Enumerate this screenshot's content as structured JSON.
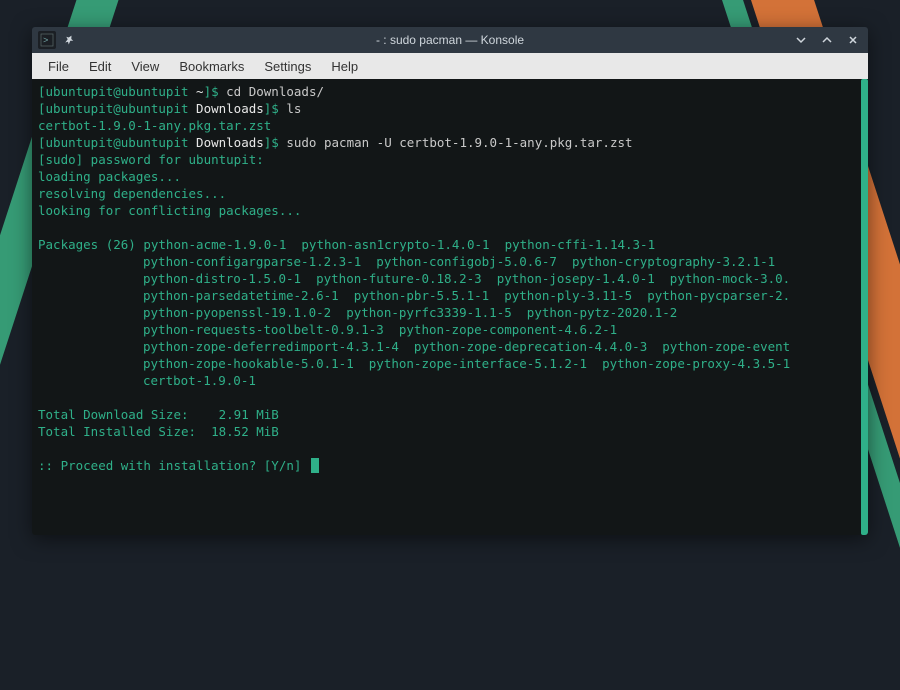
{
  "window": {
    "title": "- : sudo pacman — Konsole"
  },
  "menubar": {
    "file": "File",
    "edit": "Edit",
    "view": "View",
    "bookmarks": "Bookmarks",
    "settings": "Settings",
    "help": "Help"
  },
  "term": {
    "prompt1_userhost": "[ubuntupit@ubuntupit ",
    "prompt1_cwd": "~",
    "prompt1_end": "]$ ",
    "cmd1": "cd Downloads/",
    "prompt2_userhost": "[ubuntupit@ubuntupit ",
    "prompt2_cwd": "Downloads",
    "prompt2_end": "]$ ",
    "cmd2": "ls",
    "ls_out": "certbot-1.9.0-1-any.pkg.tar.zst",
    "prompt3_userhost": "[ubuntupit@ubuntupit ",
    "prompt3_cwd": "Downloads",
    "prompt3_end": "]$ ",
    "cmd3": "sudo pacman -U certbot-1.9.0-1-any.pkg.tar.zst",
    "sudo_line": "[sudo] password for ubuntupit:",
    "loading": "loading packages...",
    "resolving": "resolving dependencies...",
    "looking": "looking for conflicting packages...",
    "pkg_header": "Packages (26) ",
    "pkg_l1": "python-acme-1.9.0-1  python-asn1crypto-1.4.0-1  python-cffi-1.14.3-1",
    "pkg_l2": "python-configargparse-1.2.3-1  python-configobj-5.0.6-7  python-cryptography-3.2.1-1",
    "pkg_l3": "python-distro-1.5.0-1  python-future-0.18.2-3  python-josepy-1.4.0-1  python-mock-3.0.",
    "pkg_l4": "python-parsedatetime-2.6-1  python-pbr-5.5.1-1  python-ply-3.11-5  python-pycparser-2.",
    "pkg_l5": "python-pyopenssl-19.1.0-2  python-pyrfc3339-1.1-5  python-pytz-2020.1-2",
    "pkg_l6": "python-requests-toolbelt-0.9.1-3  python-zope-component-4.6.2-1",
    "pkg_l7": "python-zope-deferredimport-4.3.1-4  python-zope-deprecation-4.4.0-3  python-zope-event",
    "pkg_l8": "python-zope-hookable-5.0.1-1  python-zope-interface-5.1.2-1  python-zope-proxy-4.3.5-1",
    "pkg_l9": "certbot-1.9.0-1",
    "dl_label": "Total Download Size:    ",
    "dl_val": "2.91 MiB",
    "inst_label": "Total Installed Size:  ",
    "inst_val": "18.52 MiB",
    "proceed": ":: Proceed with installation? [Y/n] "
  }
}
